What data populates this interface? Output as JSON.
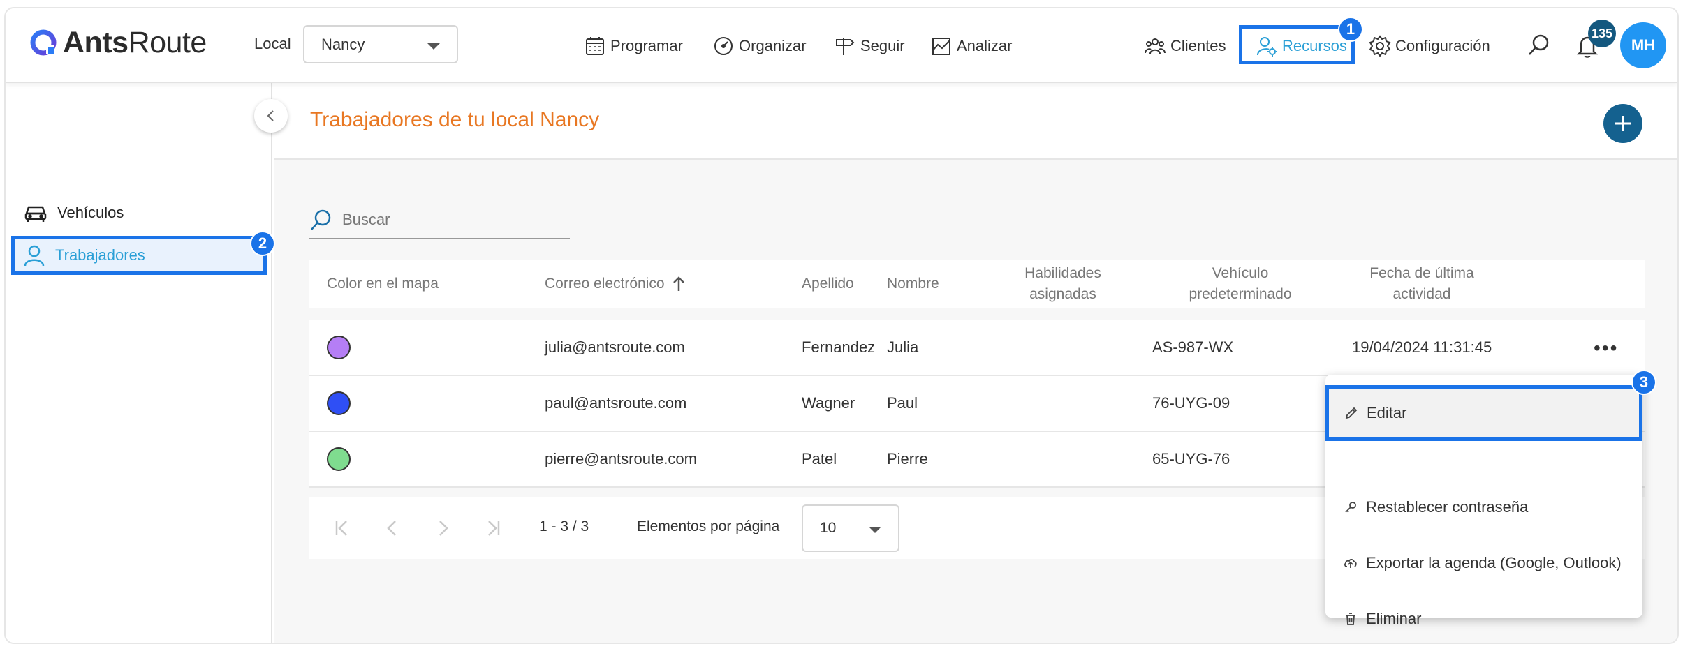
{
  "app": {
    "logo_prefix": "Ants",
    "logo_suffix": "Route",
    "local_label": "Local",
    "local_value": "Nancy"
  },
  "nav": {
    "programar": "Programar",
    "organizar": "Organizar",
    "seguir": "Seguir",
    "analizar": "Analizar",
    "clientes": "Clientes",
    "recursos": "Recursos",
    "configuracion": "Configuración",
    "notification_count": "135",
    "avatar_initials": "MH"
  },
  "sidebar": {
    "items": [
      {
        "label": "Vehículos",
        "icon": "car-icon"
      },
      {
        "label": "Trabajadores",
        "icon": "person-icon"
      }
    ]
  },
  "main": {
    "title": "Trabajadores de tu local Nancy",
    "search_placeholder": "Buscar"
  },
  "table": {
    "headers": {
      "color": "Color en el mapa",
      "email": "Correo electrónico",
      "apellido": "Apellido",
      "nombre": "Nombre",
      "habilidades_1": "Habilidades",
      "habilidades_2": "asignadas",
      "vehiculo_1": "Vehículo",
      "vehiculo_2": "predeterminado",
      "fecha_1": "Fecha de última",
      "fecha_2": "actividad"
    },
    "rows": [
      {
        "color": "#b57ef5",
        "email": "julia@antsroute.com",
        "apellido": "Fernandez",
        "nombre": "Julia",
        "vehiculo": "AS-987-WX",
        "fecha": "19/04/2024 11:31:45"
      },
      {
        "color": "#2f4ff5",
        "email": "paul@antsroute.com",
        "apellido": "Wagner",
        "nombre": "Paul",
        "vehiculo": "76-UYG-09",
        "fecha": ""
      },
      {
        "color": "#7fdc8f",
        "email": "pierre@antsroute.com",
        "apellido": "Patel",
        "nombre": "Pierre",
        "vehiculo": "65-UYG-76",
        "fecha": ""
      }
    ]
  },
  "paginator": {
    "range": "1 - 3 / 3",
    "per_page_label": "Elementos por página",
    "per_page_value": "10"
  },
  "context_menu": {
    "items": [
      {
        "label": "Editar",
        "icon": "pencil-icon"
      },
      {
        "label": "Restablecer contraseña",
        "icon": "key-icon"
      },
      {
        "label": "Exportar la agenda (Google, Outlook)",
        "icon": "cloud-upload-icon"
      },
      {
        "label": "Eliminar",
        "icon": "trash-icon"
      }
    ]
  },
  "annotations": {
    "step1": "1",
    "step2": "2",
    "step3": "3"
  },
  "colors": {
    "accent": "#1a73e8",
    "title_orange": "#e87722",
    "fab": "#14618f",
    "link_blue": "#2a9fd6"
  }
}
